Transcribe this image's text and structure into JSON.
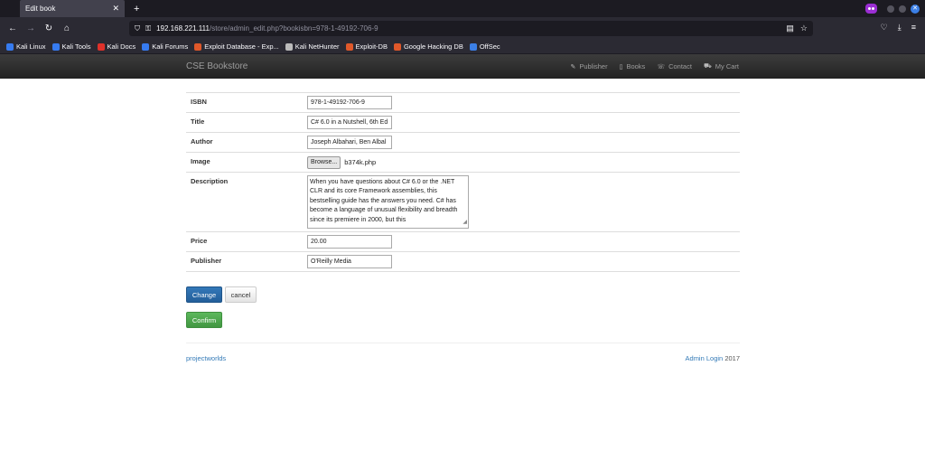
{
  "browser": {
    "tab_title": "Edit book",
    "url_host": "192.168.221.111",
    "url_path": "/store/admin_edit.php?bookisbn=978-1-49192-706-9",
    "bookmarks": [
      "Kali Linux",
      "Kali Tools",
      "Kali Docs",
      "Kali Forums",
      "Exploit Database - Exp...",
      "Kali NetHunter",
      "Exploit-DB",
      "Google Hacking DB",
      "OffSec"
    ],
    "bookmark_colors": [
      "#367bf0",
      "#367bf0",
      "#e0312a",
      "#367bf0",
      "#e0582a",
      "#bbbbbb",
      "#e0582a",
      "#e0582a",
      "#3b7fe6"
    ]
  },
  "site": {
    "brand": "CSE Bookstore",
    "nav": [
      {
        "icon": "tag-icon",
        "label": "Publisher"
      },
      {
        "icon": "book-icon",
        "label": "Books"
      },
      {
        "icon": "phone-icon",
        "label": "Contact"
      },
      {
        "icon": "cart-icon",
        "label": "My Cart"
      }
    ]
  },
  "form": {
    "isbn_label": "ISBN",
    "isbn_value": "978-1-49192-706-9",
    "title_label": "Title",
    "title_value": "C# 6.0 in a Nutshell, 6th Ed",
    "author_label": "Author",
    "author_value": "Joseph Albahari, Ben Albal",
    "image_label": "Image",
    "browse_label": "Browse...",
    "image_file": "b374k.php",
    "description_label": "Description",
    "description_value": "When you have questions about C# 6.0 or the .NET CLR and its core Framework assemblies, this bestselling guide has the answers you need. C# has become a language of unusual flexibility and breadth since its premiere in 2000, but this",
    "price_label": "Price",
    "price_value": "20.00",
    "publisher_label": "Publisher",
    "publisher_value": "O'Reilly Media",
    "change_button": "Change",
    "cancel_button": "cancel",
    "confirm_button": "Confirm"
  },
  "footer": {
    "left": "projectworlds",
    "admin_login": "Admin Login",
    "year": "2017"
  }
}
